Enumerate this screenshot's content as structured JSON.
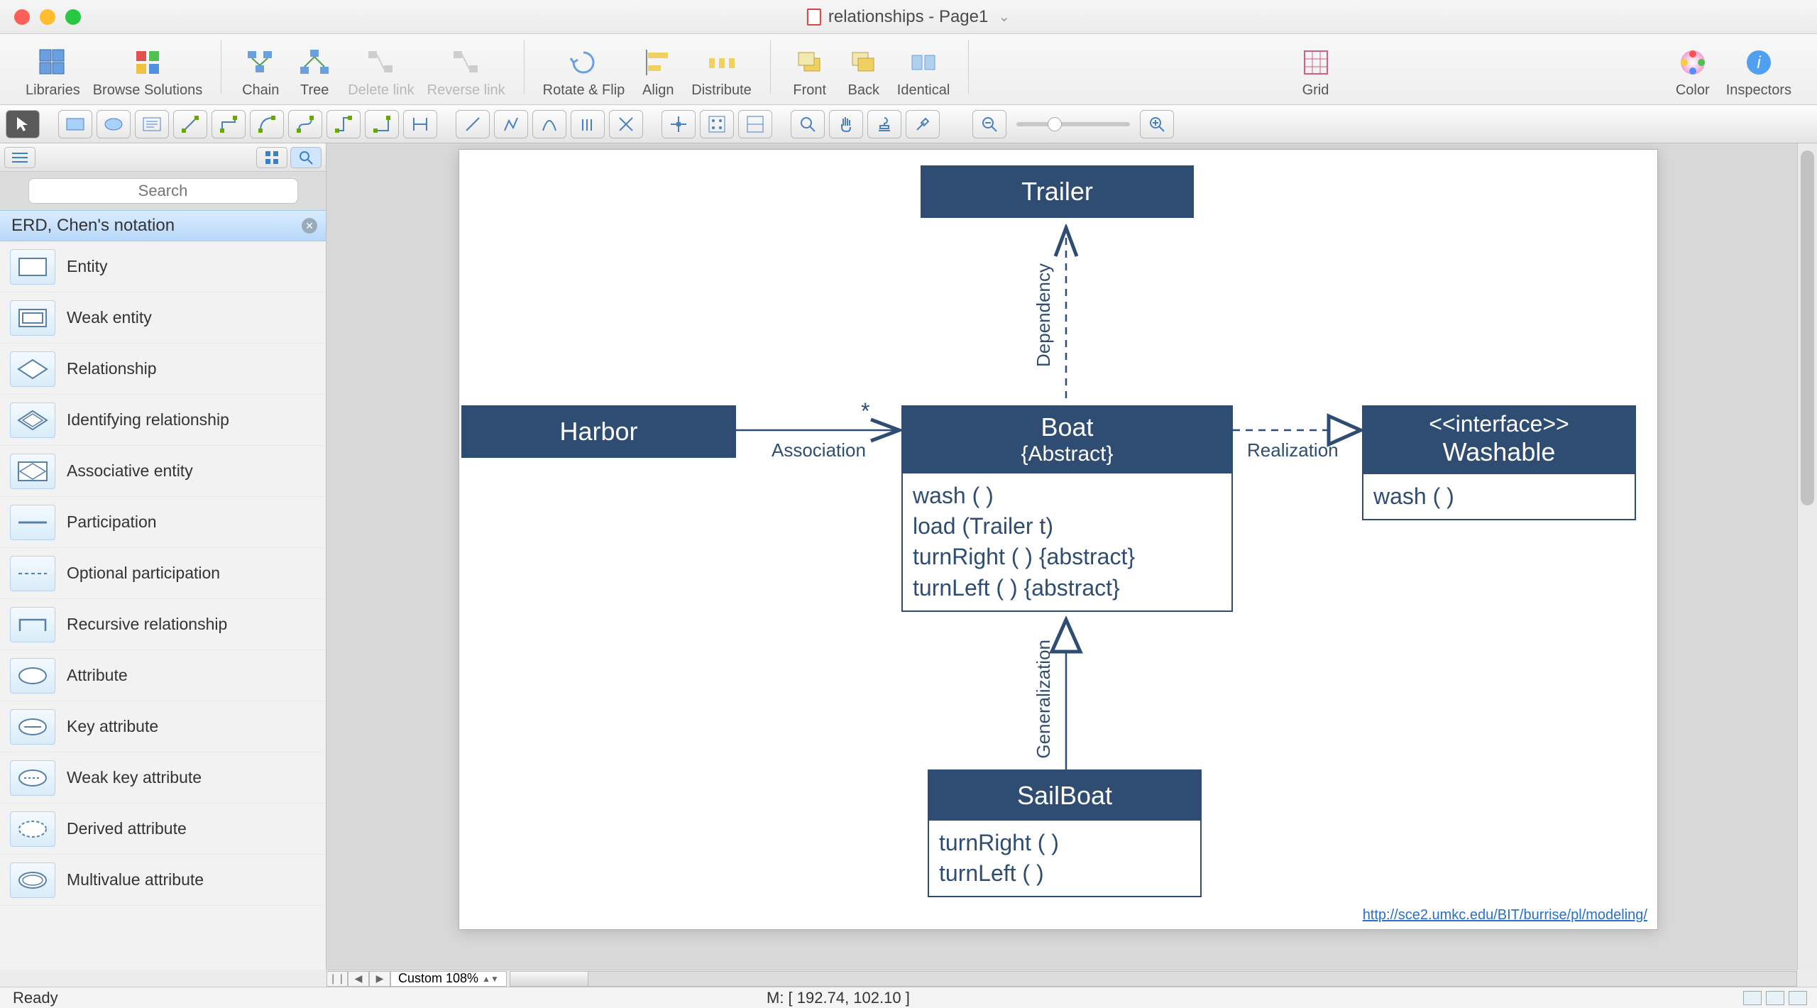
{
  "window": {
    "title": "relationships - Page1"
  },
  "toolbar": {
    "libraries": "Libraries",
    "browse": "Browse Solutions",
    "chain": "Chain",
    "tree": "Tree",
    "delete_link": "Delete link",
    "reverse_link": "Reverse link",
    "rotate_flip": "Rotate & Flip",
    "align": "Align",
    "distribute": "Distribute",
    "front": "Front",
    "back": "Back",
    "identical": "Identical",
    "grid": "Grid",
    "color": "Color",
    "inspectors": "Inspectors"
  },
  "sidebar": {
    "search_placeholder": "Search",
    "category": "ERD, Chen's notation",
    "items": [
      "Entity",
      "Weak entity",
      "Relationship",
      "Identifying relationship",
      "Associative entity",
      "Participation",
      "Optional participation",
      "Recursive relationship",
      "Attribute",
      "Key attribute",
      "Weak key attribute",
      "Derived attribute",
      "Multivalue attribute"
    ]
  },
  "diagram": {
    "trailer": "Trailer",
    "harbor": "Harbor",
    "boat_title": "Boat",
    "boat_sub": "{Abstract}",
    "boat_ops": [
      "wash ( )",
      "load (Trailer t)",
      "turnRight ( ) {abstract}",
      "turnLeft ( ) {abstract}"
    ],
    "interface_stereo": "<<interface>>",
    "interface_name": "Washable",
    "interface_ops": [
      "wash ( )"
    ],
    "sailboat": "SailBoat",
    "sailboat_ops": [
      "turnRight ( )",
      "turnLeft ( )"
    ],
    "assoc": "Association",
    "assoc_mult": "*",
    "dependency": "Dependency",
    "realization": "Realization",
    "generalization": "Generalization",
    "source_url": "http://sce2.umkc.edu/BIT/burrise/pl/modeling/"
  },
  "footer": {
    "zoom": "Custom 108%",
    "status": "Ready",
    "mouse": "M: [ 192.74, 102.10 ]"
  }
}
